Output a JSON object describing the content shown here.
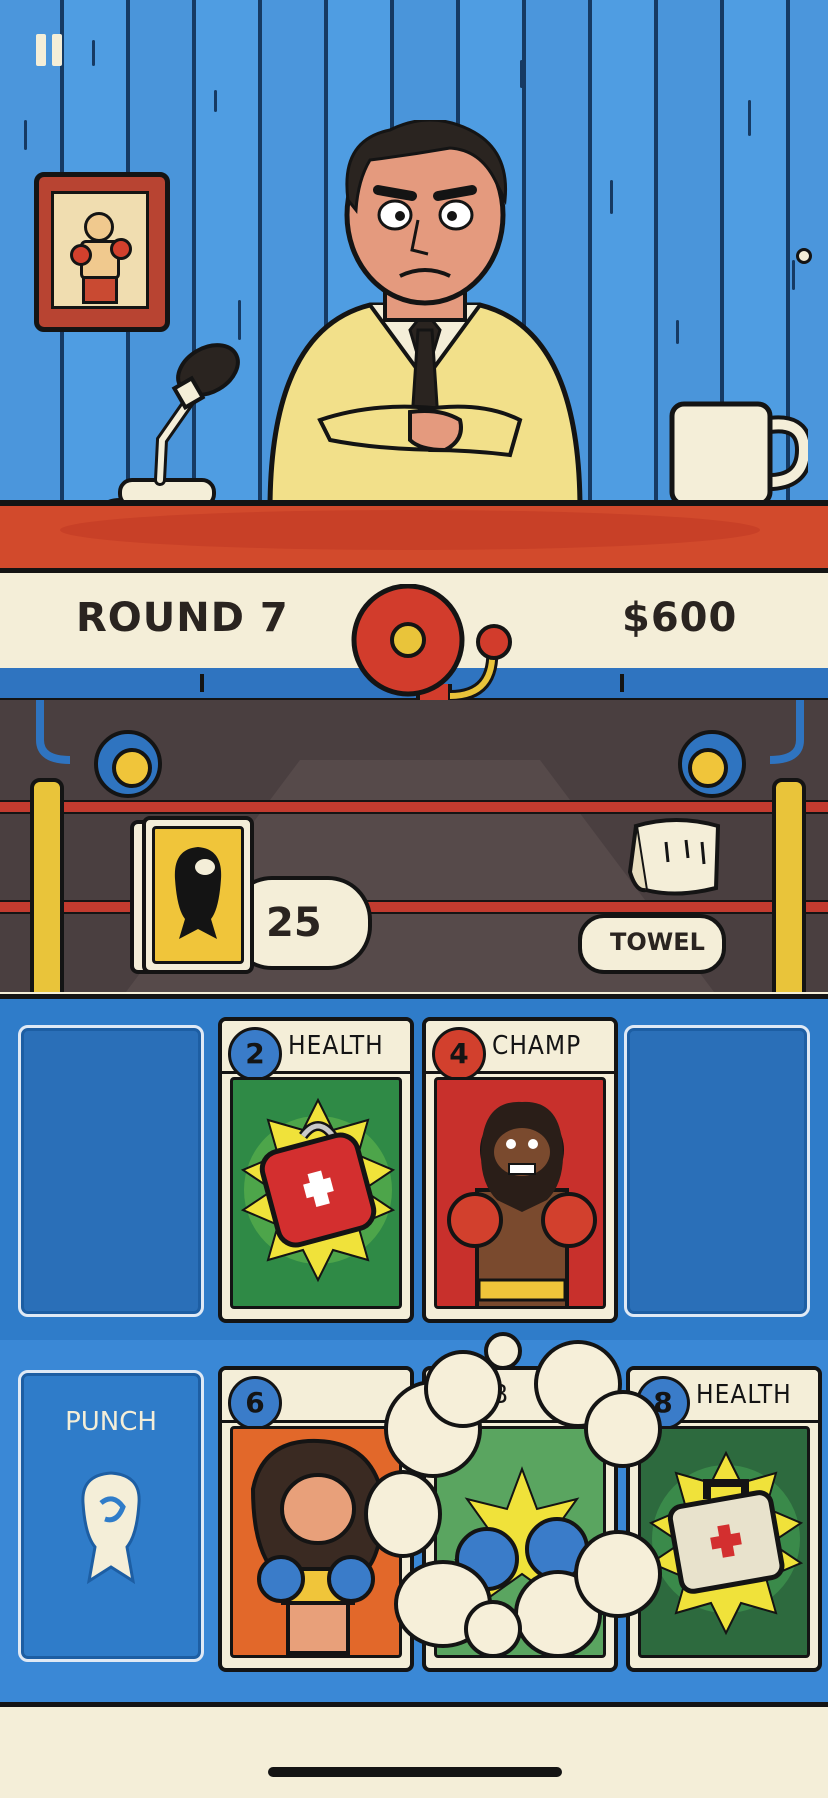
{
  "hud": {
    "pause_label": "II",
    "round": "ROUND 7",
    "money": "$600"
  },
  "deck": {
    "count": "25"
  },
  "towel": {
    "label": "TOWEL"
  },
  "opponent_row": [
    {
      "cost": "2",
      "title": "HEALTH",
      "kind": "health"
    },
    {
      "cost": "4",
      "title": "CHAMP",
      "kind": "champ"
    }
  ],
  "player_row": {
    "punch_slot": {
      "label": "PUNCH"
    },
    "cards": [
      {
        "cost": "6",
        "title": "",
        "kind": "fighter"
      },
      {
        "cost": "",
        "title": "B",
        "kind": "gloves"
      },
      {
        "cost": "8",
        "title": "HEALTH",
        "kind": "health"
      }
    ]
  },
  "colors": {
    "wall": "#4d9be0",
    "desk": "#d24a2c",
    "ring": "#4a3f40",
    "table": "#2f7cc9",
    "card": "#f4eed8"
  }
}
